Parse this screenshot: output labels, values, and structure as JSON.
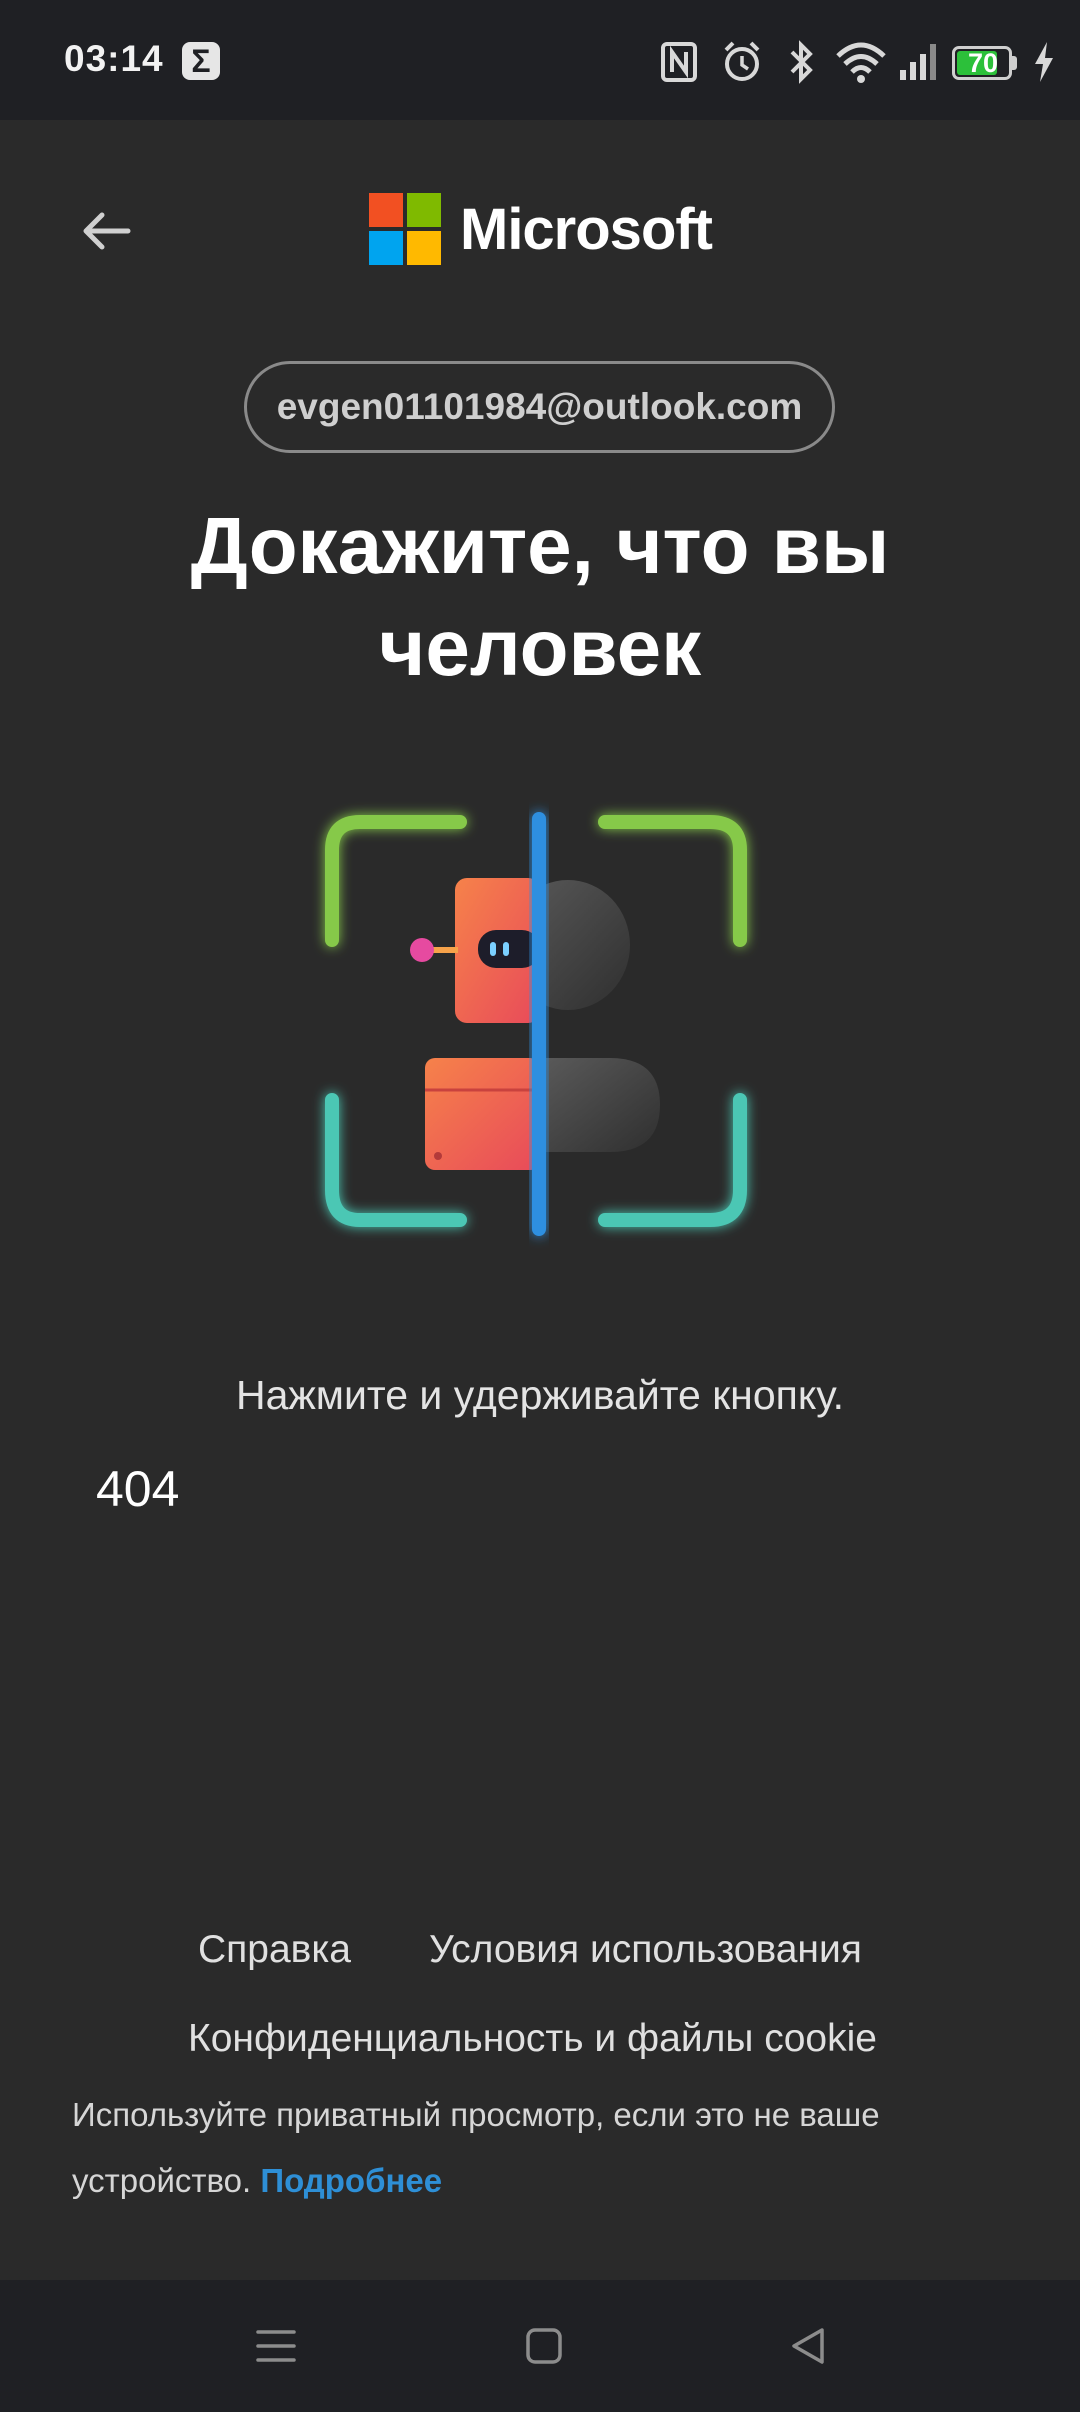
{
  "status_bar": {
    "time": "03:14",
    "notification_glyph": "Σ",
    "battery_level": "70",
    "icons": [
      "nfc-icon",
      "alarm-icon",
      "bluetooth-icon",
      "wifi-icon",
      "signal-icon",
      "battery-icon",
      "charging-icon"
    ]
  },
  "header": {
    "brand": "Microsoft",
    "logo_colors": [
      "#f25022",
      "#7fba00",
      "#00a4ef",
      "#ffb900"
    ]
  },
  "account": {
    "email": "evgen01101984@outlook.com"
  },
  "main": {
    "title": "Докажите, что вы человек",
    "instruction": "Нажмите и удерживайте кнопку.",
    "error_code": "404"
  },
  "footer": {
    "help": "Справка",
    "terms": "Условия использования",
    "privacy": "Конфиденциальность и файлы cookie",
    "private_note": "Используйте приватный просмотр, если это не ваше устройство.",
    "more_link": "Подробнее"
  },
  "colors": {
    "background": "#2a2a2a",
    "bar": "#1f2024",
    "link": "#2e8fd6",
    "frame_green": "#86c94a",
    "frame_teal": "#4cc7b4",
    "divider_blue": "#2f8fe0",
    "robot_orange": "#f26a3e"
  }
}
